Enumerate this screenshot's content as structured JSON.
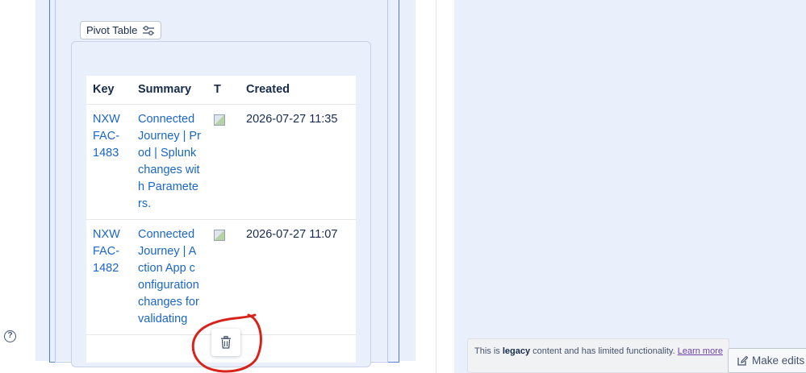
{
  "pivot_button": {
    "label": "Pivot Table",
    "icon": "sliders-icon"
  },
  "table": {
    "headers": [
      "Key",
      "Summary",
      "T",
      "Created"
    ],
    "rows": [
      {
        "key": "NXWFAC-1483",
        "summary": "Connected Journey | Prod | Splunk changes with Parameters.",
        "created": "2026-07-27 11:35"
      },
      {
        "key": "NXWFAC-1482",
        "summary": "Connected Journey | Action App configuration changes for validating",
        "created": "2026-07-27 11:07"
      }
    ]
  },
  "legacy_notice": {
    "prefix": "This is ",
    "bold": "legacy",
    "suffix": " content and has limited functionality. ",
    "link": "Learn more"
  },
  "make_edits": {
    "label": "Make edits"
  },
  "colors": {
    "link": "#1a66c8",
    "panel_bg": "#e9f0fc",
    "frame": "#4c7bd9",
    "annotation": "#d8231c"
  }
}
